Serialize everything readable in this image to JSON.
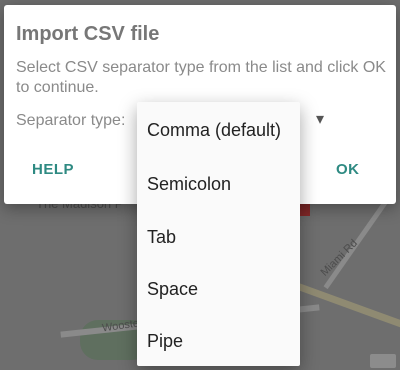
{
  "map": {
    "labels": [
      "The Madison P",
      "Miami Rd",
      "Wooste"
    ]
  },
  "dialog": {
    "title": "Import CSV file",
    "message": "Select CSV separator type from the list and click OK to continue.",
    "separator_label": "Separator type:",
    "help_button": "HELP",
    "ok_button": "OK"
  },
  "dropdown": {
    "options": [
      "Comma (default)",
      "Semicolon",
      "Tab",
      "Space",
      "Pipe"
    ]
  }
}
